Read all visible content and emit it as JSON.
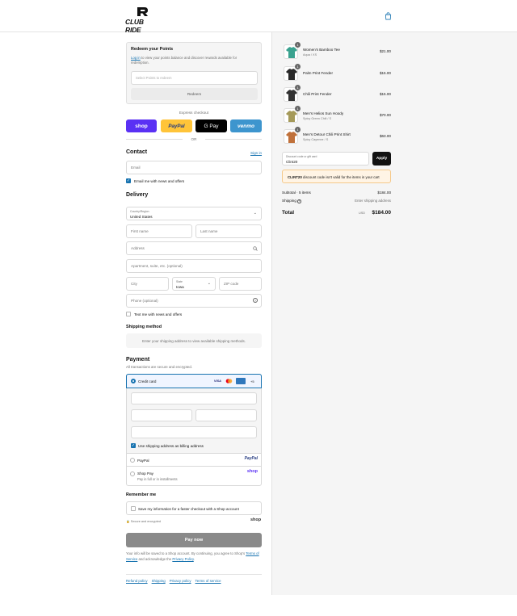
{
  "brand": {
    "name": "CLUB RIDE"
  },
  "redeem": {
    "title": "Redeem your Points",
    "login_link": "Log in",
    "login_text": " to view your points balance and discover rewards available for redemption.",
    "select_placeholder": "Select Points to redeem",
    "button": "Redeem"
  },
  "express": {
    "label": "Express checkout",
    "or": "OR",
    "shop": "shop",
    "paypal": "PayPal",
    "gpay": "G Pay",
    "venmo": "venmo"
  },
  "contact": {
    "title": "Contact",
    "signin": "Sign in",
    "email_placeholder": "Email",
    "news_label": "Email me with news and offers"
  },
  "delivery": {
    "title": "Delivery",
    "country_label": "Country/Region",
    "country_value": "United States",
    "first_name": "First name",
    "last_name": "Last name",
    "address": "Address",
    "apartment": "Apartment, suite, etc. (optional)",
    "city": "City",
    "state_label": "State",
    "state_value": "Iowa",
    "zip": "ZIP code",
    "phone": "Phone (optional)",
    "text_label": "Text me with news and offers"
  },
  "shipping_method": {
    "title": "Shipping method",
    "note": "Enter your shipping address to view available shipping methods."
  },
  "payment": {
    "title": "Payment",
    "subtitle": "All transactions are secure and encrypted.",
    "credit_card": "Credit card",
    "card_visa": "VISA",
    "card_more": "+5",
    "billing_label": "Use shipping address as billing address",
    "paypal": "PayPal",
    "paypal_logo": "PayPal",
    "shoppay": "Shop Pay",
    "shoppay_sub": "Pay in full or in installments",
    "shoppay_logo": "shop"
  },
  "remember": {
    "title": "Remember me",
    "save_label": "Save my information for a faster checkout with a Shop account",
    "secure": "Secure and encrypted",
    "shop_logo": "shop"
  },
  "paynow": {
    "label": "Pay now"
  },
  "legal": {
    "text1": "Your info will be saved to a Shop account. By continuing, you agree to Shop's",
    "terms": "Terms of Service",
    "text2": " and acknowledge the ",
    "privacy": "Privacy Policy",
    "text3": "."
  },
  "footer": {
    "links": [
      "Refund policy",
      "Shipping",
      "Privacy policy",
      "Terms of service"
    ]
  },
  "cart": {
    "items": [
      {
        "name": "Women's Bamboo Tee",
        "variant": "Aqua / XS",
        "price": "$21.00",
        "qty": "1",
        "color": "#3aa28f"
      },
      {
        "name": "Palm Print Fender",
        "variant": "",
        "price": "$15.00",
        "qty": "1",
        "color": "#2a2a2a"
      },
      {
        "name": "Chili Print Fender",
        "variant": "",
        "price": "$15.00",
        "qty": "1",
        "color": "#333333"
      },
      {
        "name": "Men's Helios Sun Hoody",
        "variant": "Spicy Green Chili / S",
        "price": "$70.00",
        "qty": "1",
        "color": "#a59a5a"
      },
      {
        "name": "Men's Detour Chili Print Shirt",
        "variant": "Spicy Cayenne / S",
        "price": "$63.00",
        "qty": "1",
        "color": "#c0713b"
      }
    ],
    "discount_label": "Discount code or gift card",
    "discount_value": "Clint20",
    "apply": "Apply",
    "error_code": "CLINT20",
    "error_text": " discount code isn't valid for the items in your cart",
    "subtotal_label": "Subtotal · 5 items",
    "subtotal_value": "$184.00",
    "shipping_label": "Shipping",
    "shipping_value": "Enter shipping address",
    "total_label": "Total",
    "currency": "USD",
    "total_value": "$184.00"
  }
}
